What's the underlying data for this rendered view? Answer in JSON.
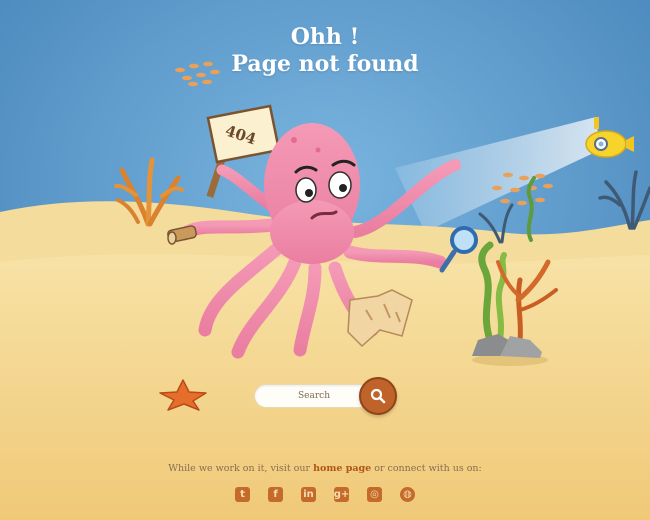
{
  "heading": {
    "line1": "Ohh !",
    "line2": "Page not found"
  },
  "sign": {
    "text": "404"
  },
  "search": {
    "placeholder": "Search"
  },
  "footer": {
    "before": "While we work on it, visit our ",
    "link": "home page",
    "after": " or connect with us on:"
  },
  "social": [
    {
      "name": "twitter",
      "glyph": "t"
    },
    {
      "name": "facebook",
      "glyph": "f"
    },
    {
      "name": "linkedin",
      "glyph": "in"
    },
    {
      "name": "google-plus",
      "glyph": "g+"
    },
    {
      "name": "instagram",
      "glyph": "◎"
    },
    {
      "name": "dribbble",
      "glyph": "◍"
    }
  ],
  "colors": {
    "sea": "#5b9ac8",
    "sand": "#f3d58e",
    "accent": "#c0632a",
    "octopus": "#f08cab"
  }
}
